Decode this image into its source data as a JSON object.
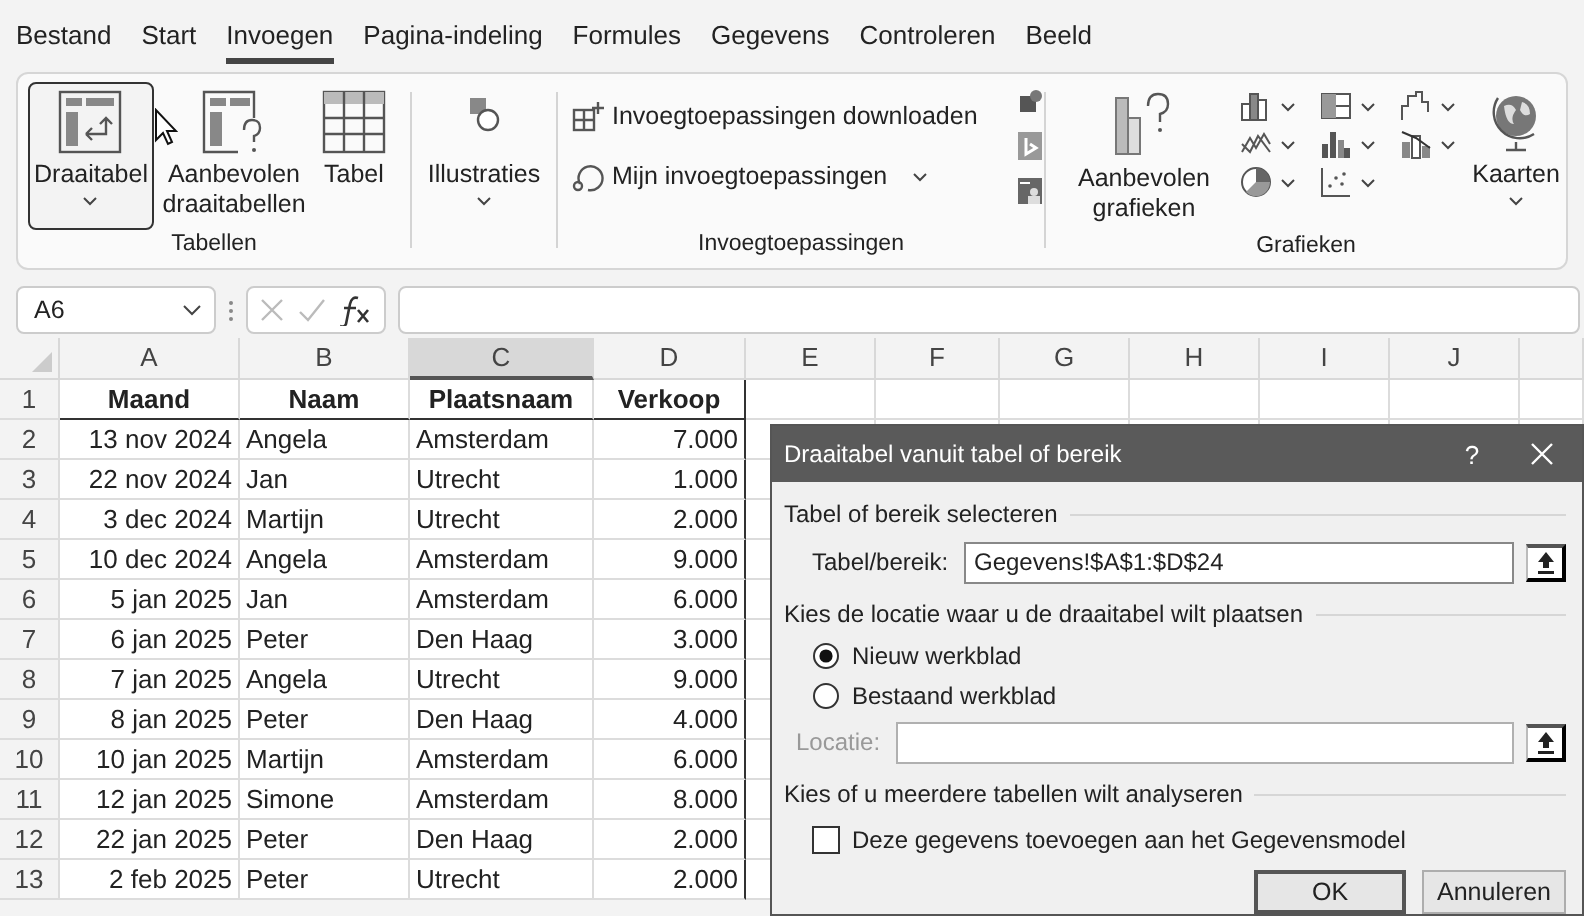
{
  "ribbon_tabs": [
    {
      "label": "Bestand",
      "selected": false
    },
    {
      "label": "Start",
      "selected": false
    },
    {
      "label": "Invoegen",
      "selected": true
    },
    {
      "label": "Pagina-indeling",
      "selected": false
    },
    {
      "label": "Formules",
      "selected": false
    },
    {
      "label": "Gegevens",
      "selected": false
    },
    {
      "label": "Controleren",
      "selected": false
    },
    {
      "label": "Beeld",
      "selected": false
    }
  ],
  "ribbon_groups": [
    {
      "kind": "large",
      "label": "Tabellen",
      "buttons": [
        {
          "label": "Draaitabel",
          "highlighted": true,
          "dropdown": true
        },
        {
          "label": "Aanbevolen draaitabellen",
          "highlighted": false,
          "dropdown": false
        },
        {
          "label": "Tabel",
          "highlighted": false,
          "dropdown": false
        }
      ]
    },
    {
      "kind": "large",
      "buttons": [
        {
          "label": "Illustraties",
          "highlighted": false,
          "dropdown": true
        }
      ]
    },
    {
      "kind": "addins",
      "label": "Invoegtoepassingen",
      "buttons": [
        {
          "label": "Invoegtoepassingen downloaden",
          "dropdown": false
        },
        {
          "label": "Mijn invoegtoepassingen",
          "dropdown": true
        }
      ]
    },
    {
      "kind": "charts",
      "label": "Grafieken",
      "buttons": [
        {
          "label": "Aanbevolen grafieken",
          "highlighted": false,
          "dropdown": false
        },
        {
          "label": "Kaarten",
          "highlighted": false,
          "dropdown": true
        }
      ]
    }
  ],
  "name_box": "A6",
  "sheet": {
    "columns": [
      {
        "label": "A",
        "selected": false
      },
      {
        "label": "B",
        "selected": false
      },
      {
        "label": "C",
        "selected": true
      },
      {
        "label": "D",
        "selected": false
      },
      {
        "label": "E",
        "selected": false
      },
      {
        "label": "F",
        "selected": false
      },
      {
        "label": "G",
        "selected": false
      },
      {
        "label": "H",
        "selected": false
      },
      {
        "label": "I",
        "selected": false
      },
      {
        "label": "J",
        "selected": false
      }
    ],
    "rows": [
      {
        "number": "1",
        "kind": "header",
        "cells": [
          "Maand",
          "Naam",
          "Plaatsnaam",
          "Verkoop"
        ]
      },
      {
        "number": "2",
        "kind": "data",
        "cells": [
          "13 nov 2024",
          "Angela",
          "Amsterdam",
          "7.000"
        ]
      },
      {
        "number": "3",
        "kind": "data",
        "cells": [
          "22 nov 2024",
          "Jan",
          "Utrecht",
          "1.000"
        ]
      },
      {
        "number": "4",
        "kind": "data",
        "cells": [
          "3 dec 2024",
          "Martijn",
          "Utrecht",
          "2.000"
        ]
      },
      {
        "number": "5",
        "kind": "data",
        "cells": [
          "10 dec 2024",
          "Angela",
          "Amsterdam",
          "9.000"
        ]
      },
      {
        "number": "6",
        "kind": "data",
        "cells": [
          "5 jan 2025",
          "Jan",
          "Amsterdam",
          "6.000"
        ]
      },
      {
        "number": "7",
        "kind": "data",
        "cells": [
          "6 jan 2025",
          "Peter",
          "Den Haag",
          "3.000"
        ]
      },
      {
        "number": "8",
        "kind": "data",
        "cells": [
          "7 jan 2025",
          "Angela",
          "Utrecht",
          "9.000"
        ]
      },
      {
        "number": "9",
        "kind": "data",
        "cells": [
          "8 jan 2025",
          "Peter",
          "Den Haag",
          "4.000"
        ]
      },
      {
        "number": "10",
        "kind": "data",
        "cells": [
          "10 jan 2025",
          "Martijn",
          "Amsterdam",
          "6.000"
        ]
      },
      {
        "number": "11",
        "kind": "data",
        "cells": [
          "12 jan 2025",
          "Simone",
          "Amsterdam",
          "8.000"
        ]
      },
      {
        "number": "12",
        "kind": "data",
        "cells": [
          "22 jan 2025",
          "Peter",
          "Den Haag",
          "2.000"
        ]
      },
      {
        "number": "13",
        "kind": "data",
        "cells": [
          "2 feb 2025",
          "Peter",
          "Utrecht",
          "2.000"
        ]
      }
    ]
  },
  "dialog": {
    "title": "Draaitabel vanuit tabel of bereik",
    "help": "?",
    "source": {
      "heading": "Tabel of bereik selecteren",
      "label": "Tabel/bereik:",
      "value": "Gegevens!$A$1:$D$24"
    },
    "location": {
      "heading": "Kies de locatie waar u de draaitabel wilt plaatsen",
      "options": [
        {
          "label": "Nieuw werkblad",
          "selected": true
        },
        {
          "label": "Bestaand werkblad",
          "selected": false
        }
      ],
      "field_label": "Locatie:",
      "field_disabled": true
    },
    "multiple": {
      "heading": "Kies of u meerdere tabellen wilt analyseren",
      "checkbox": {
        "label": "Deze gegevens toevoegen aan het Gegevensmodel",
        "checked": false
      }
    },
    "buttons": [
      {
        "label": "OK",
        "default": true
      },
      {
        "label": "Annuleren",
        "default": false
      }
    ]
  }
}
